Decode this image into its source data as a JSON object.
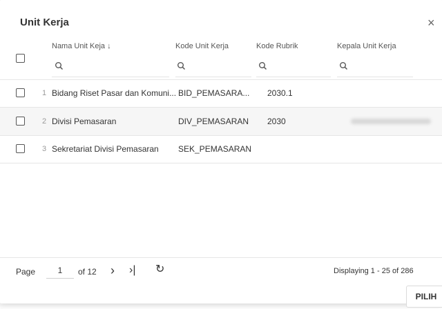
{
  "dialog": {
    "title": "Unit Kerja",
    "close_symbol": "×"
  },
  "columns": [
    {
      "label": "Nama Unit Keja ↓"
    },
    {
      "label": "Kode Unit Kerja"
    },
    {
      "label": "Kode Rubrik"
    },
    {
      "label": "Kepala Unit Kerja"
    }
  ],
  "rows": [
    {
      "num": "1",
      "nama": "Bidang Riset Pasar dan Komuni...",
      "kode": "BID_PEMASARA...",
      "rubrik": "2030.1"
    },
    {
      "num": "2",
      "nama": "Divisi Pemasaran",
      "kode": "DIV_PEMASARAN",
      "rubrik": "2030"
    },
    {
      "num": "3",
      "nama": "Sekretariat Divisi Pemasaran",
      "kode": "SEK_PEMASARAN",
      "rubrik": ""
    }
  ],
  "pager": {
    "page_label": "Page",
    "current_page": "1",
    "of_label": "of 12",
    "next_symbol": "›",
    "last_symbol": "›|",
    "refresh_symbol": "↻",
    "displaying": "Displaying 1 - 25 of 286"
  },
  "footer": {
    "select_label": "PILIH"
  },
  "colors": {
    "row_alt": "#f6f6f6",
    "border": "#e6e6e6"
  }
}
